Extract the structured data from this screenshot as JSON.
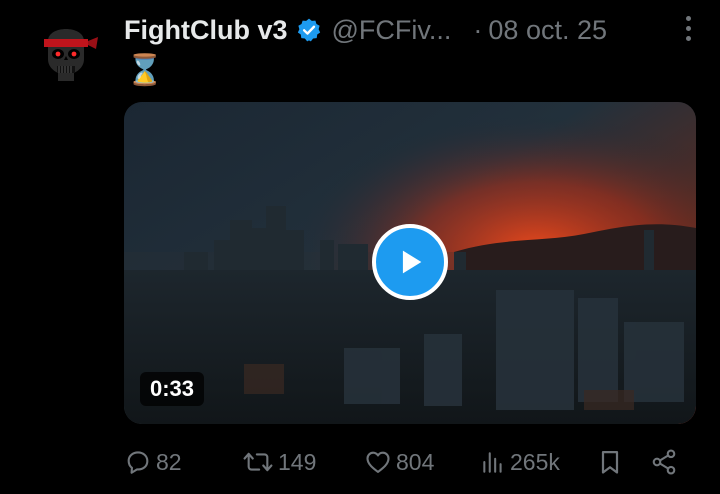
{
  "tweet": {
    "author_name": "FightClub v3",
    "handle": "@FCFiv...",
    "separator": "·",
    "date": "08 oct. 25",
    "text": "⌛",
    "video_duration": "0:33"
  },
  "actions": {
    "replies": "82",
    "reposts": "149",
    "likes": "804",
    "views": "265k"
  },
  "colors": {
    "background": "#000000",
    "primary_text": "#e7e9ea",
    "secondary_text": "#71767b",
    "accent": "#1d9bf0",
    "avatar_bandana": "#c0141c",
    "sunset": "#e0401a"
  },
  "icons": [
    "verified-badge-icon",
    "more-options-icon",
    "play-icon",
    "reply-icon",
    "repost-icon",
    "like-icon",
    "views-icon",
    "bookmark-icon",
    "share-icon"
  ]
}
